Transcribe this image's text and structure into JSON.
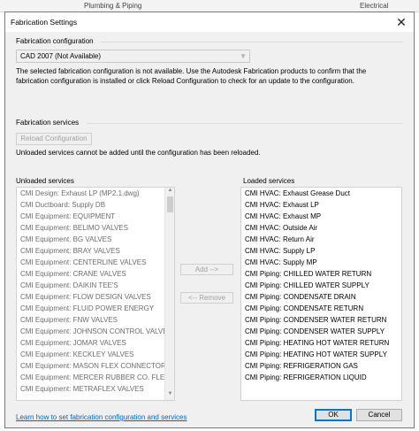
{
  "background": {
    "left_label": "Plumbing & Piping",
    "right_label": "Electrical"
  },
  "dialog": {
    "title": "Fabrication Settings",
    "close_glyph": "✕"
  },
  "configuration": {
    "section_label": "Fabrication configuration",
    "selected_value": "CAD 2007 (Not Available)",
    "message_line1": "The selected fabrication configuration is not available. Use the Autodesk Fabrication products to confirm that the",
    "message_line2": "fabrication configuration is installed or click Reload Configuration to check for an update to the configuration."
  },
  "services": {
    "section_label": "Fabrication services",
    "reload_button": "Reload Configuration",
    "note": "Unloaded services cannot be added until the configuration has been reloaded."
  },
  "unloaded": {
    "label": "Unloaded services",
    "items": [
      "CMI Design: Exhaust LP (MP2.1.dwg)",
      "CMI Ductboard: Supply DB",
      "CMI Equipment:  EQUIPMENT",
      "CMI Equipment: BELIMO VALVES",
      "CMI Equipment: BG VALVES",
      "CMI Equipment: BRAY VALVES",
      "CMI Equipment: CENTERLINE VALVES",
      "CMI Equipment: CRANE VALVES",
      "CMI Equipment: DAIKIN TEE'S",
      "CMI Equipment: FLOW DESIGN VALVES",
      "CMI Equipment: FLUID POWER ENERGY",
      "CMI Equipment: FNW VALVES",
      "CMI Equipment: JOHNSON CONTROL VALVES",
      "CMI Equipment: JOMAR VALVES",
      "CMI Equipment: KECKLEY VALVES",
      "CMI Equipment: MASON FLEX CONNECTORS",
      "CMI Equipment: MERCER RUBBER CO. FLEX CO",
      "CMI Equipment: METRAFLEX VALVES"
    ]
  },
  "loaded": {
    "label": "Loaded services",
    "items": [
      "CMI HVAC: Exhaust Grease Duct",
      "CMI HVAC: Exhaust LP",
      "CMI HVAC: Exhaust MP",
      "CMI HVAC: Outside Air",
      "CMI HVAC: Return Air",
      "CMI HVAC: Supply LP",
      "CMI HVAC: Supply MP",
      "CMI Piping: CHILLED WATER RETURN",
      "CMI Piping: CHILLED WATER SUPPLY",
      "CMI Piping: CONDENSATE DRAIN",
      "CMI Piping: CONDENSATE RETURN",
      "CMI Piping: CONDENSER WATER RETURN",
      "CMI Piping: CONDENSER WATER SUPPLY",
      "CMI Piping: HEATING HOT WATER RETURN",
      "CMI Piping: HEATING HOT WATER SUPPLY",
      "CMI Piping: REFRIGERATION GAS",
      "CMI Piping: REFRIGERATION LIQUID"
    ]
  },
  "transfer": {
    "add_button": "Add -->",
    "remove_button": "<-- Remove"
  },
  "footer": {
    "help_link": "Learn how to set fabrication configuration and services",
    "ok_button": "OK",
    "cancel_button": "Cancel"
  },
  "colors": {
    "link": "#0066cc",
    "accent_border": "#0078d7",
    "dialog_background": "#f0f0f0"
  }
}
